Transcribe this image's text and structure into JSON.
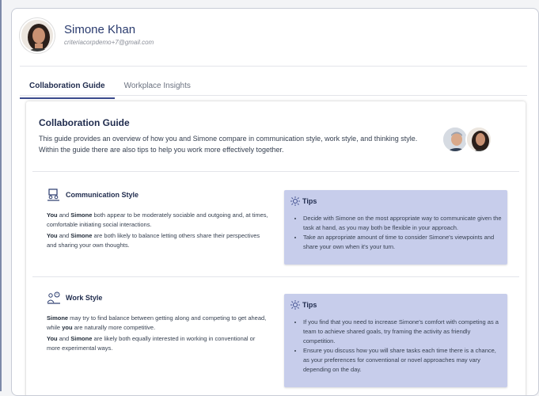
{
  "profile": {
    "name": "Simone Khan",
    "email": "criteriacorpdemo+7@gmail.com"
  },
  "tabs": [
    {
      "label": "Collaboration Guide",
      "active": true
    },
    {
      "label": "Workplace Insights",
      "active": false
    }
  ],
  "guide": {
    "title": "Collaboration Guide",
    "description": "This guide provides an overview of how you and Simone compare in communication style, work style, and thinking style. Within the guide there are also tips to help you work more effectively together."
  },
  "communication": {
    "title": "Communication Style",
    "p1": [
      {
        "t": "You",
        "b": true
      },
      {
        "t": " and ",
        "b": false
      },
      {
        "t": "Simone",
        "b": true
      },
      {
        "t": " both appear to be moderately sociable and outgoing and, at times, comfortable initiating social interactions.",
        "b": false
      }
    ],
    "p2": [
      {
        "t": "You",
        "b": true
      },
      {
        "t": " and ",
        "b": false
      },
      {
        "t": "Simone",
        "b": true
      },
      {
        "t": " are both likely to balance letting others share their perspectives and sharing your own thoughts.",
        "b": false
      }
    ],
    "tips_title": "Tips",
    "tips": [
      "Decide with Simone on the most appropriate way to communicate given the task at hand, as you may both be flexible in your approach.",
      "Take an appropriate amount of time to consider Simone's viewpoints and share your own when it's your turn."
    ]
  },
  "work": {
    "title": "Work Style",
    "p1": [
      {
        "t": "Simone",
        "b": true
      },
      {
        "t": " may try to find balance between getting along and competing to get ahead, while ",
        "b": false
      },
      {
        "t": "you",
        "b": true
      },
      {
        "t": " are naturally more competitive.",
        "b": false
      }
    ],
    "p2": [
      {
        "t": "You",
        "b": true
      },
      {
        "t": " and ",
        "b": false
      },
      {
        "t": "Simone",
        "b": true
      },
      {
        "t": " are likely both equally interested in working in conventional or more experimental ways.",
        "b": false
      }
    ],
    "tips_title": "Tips",
    "tips": [
      "If you find that you need to increase Simone's comfort with competing as a team to achieve shared goals, try framing the activity as friendly competition.",
      "Ensure you discuss how you will share tasks each time there is a chance, as your preferences for conventional or novel approaches may vary depending on the day."
    ]
  },
  "colors": {
    "accent": "#3b4a8c",
    "tips_bg": "#c7cdeb",
    "title": "#1f2b4d"
  }
}
